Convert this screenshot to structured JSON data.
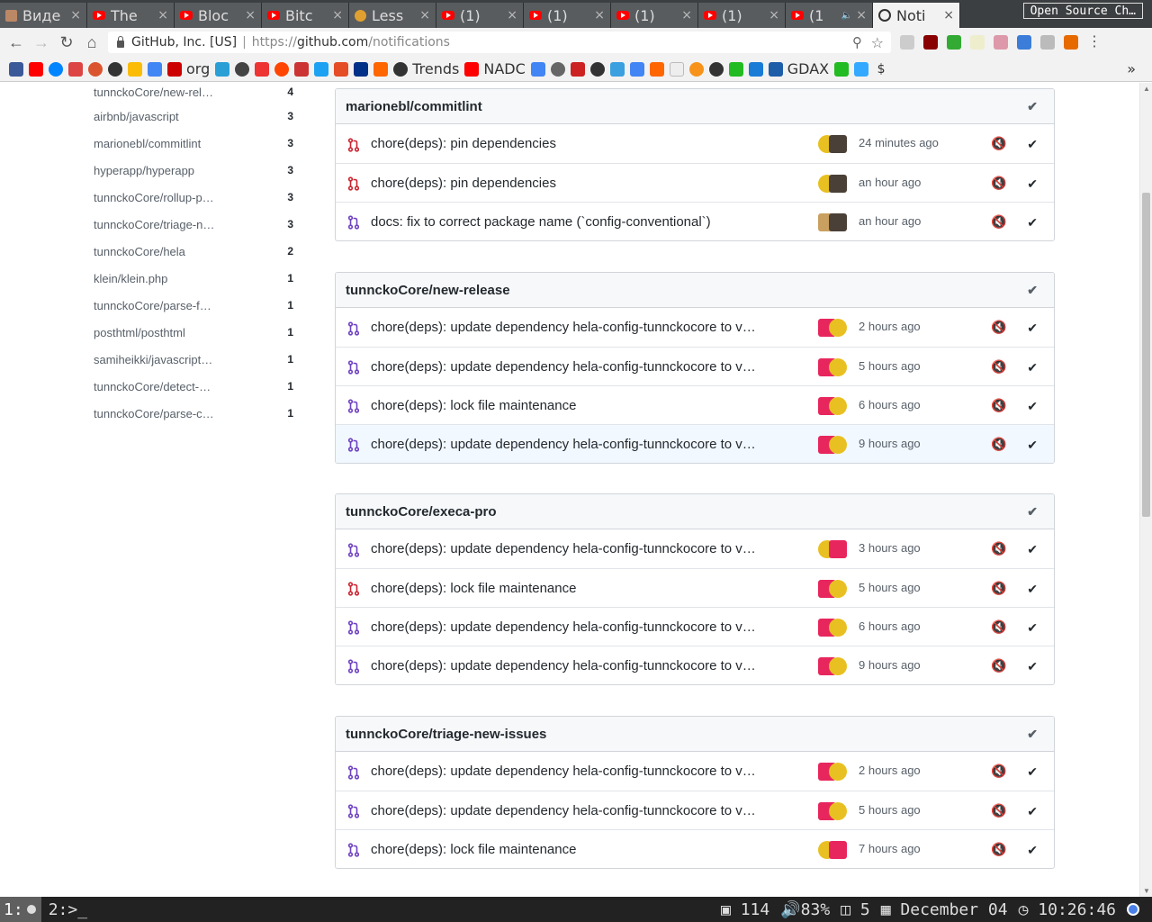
{
  "tabs": [
    {
      "title": "Виде",
      "kind": "vide"
    },
    {
      "title": "The",
      "kind": "yt"
    },
    {
      "title": "Bloc",
      "kind": "yt"
    },
    {
      "title": "Bitc",
      "kind": "yt"
    },
    {
      "title": "Less",
      "kind": "lesson"
    },
    {
      "title": "(1)",
      "kind": "yt"
    },
    {
      "title": "(1)",
      "kind": "yt"
    },
    {
      "title": "(1)",
      "kind": "yt"
    },
    {
      "title": "(1)",
      "kind": "yt"
    },
    {
      "title": "(1",
      "kind": "yt"
    },
    {
      "title": "Noti",
      "kind": "gh"
    }
  ],
  "tab_close": "×",
  "profile_button": "Open Source Ch…",
  "address": {
    "org": "GitHub, Inc. [US]",
    "scheme": "https://",
    "host": "github.com",
    "path": "/notifications"
  },
  "bookmarks": {
    "org": "org",
    "trends": "Trends",
    "nadc": "NADC",
    "gdax": "GDAX",
    "more": "»"
  },
  "sidebar": [
    {
      "repo": "tunnckoCore/new-rel…",
      "count": "4"
    },
    {
      "repo": "airbnb/javascript",
      "count": "3"
    },
    {
      "repo": "marionebl/commitlint",
      "count": "3"
    },
    {
      "repo": "hyperapp/hyperapp",
      "count": "3"
    },
    {
      "repo": "tunnckoCore/rollup-p…",
      "count": "3"
    },
    {
      "repo": "tunnckoCore/triage-n…",
      "count": "3"
    },
    {
      "repo": "tunnckoCore/hela",
      "count": "2"
    },
    {
      "repo": "klein/klein.php",
      "count": "1"
    },
    {
      "repo": "tunnckoCore/parse-f…",
      "count": "1"
    },
    {
      "repo": "posthtml/posthtml",
      "count": "1"
    },
    {
      "repo": "samiheikki/javascript…",
      "count": "1"
    },
    {
      "repo": "tunnckoCore/detect-…",
      "count": "1"
    },
    {
      "repo": "tunnckoCore/parse-c…",
      "count": "1"
    }
  ],
  "groups": [
    {
      "repo": "marionebl/commitlint",
      "items": [
        {
          "title": "chore(deps): pin dependencies",
          "time": "24 minutes ago",
          "state": "closed",
          "avatars": [
            "y",
            "d"
          ]
        },
        {
          "title": "chore(deps): pin dependencies",
          "time": "an hour ago",
          "state": "closed",
          "avatars": [
            "y",
            "d"
          ]
        },
        {
          "title": "docs: fix to correct package name (`config-conventional`)",
          "time": "an hour ago",
          "state": "merged",
          "avatars": [
            "t",
            "d"
          ]
        }
      ]
    },
    {
      "repo": "tunnckoCore/new-release",
      "items": [
        {
          "title": "chore(deps): update dependency hela-config-tunnckocore to v…",
          "time": "2 hours ago",
          "state": "merged",
          "avatars": [
            "r",
            "y"
          ]
        },
        {
          "title": "chore(deps): update dependency hela-config-tunnckocore to v…",
          "time": "5 hours ago",
          "state": "merged",
          "avatars": [
            "r",
            "y"
          ]
        },
        {
          "title": "chore(deps): lock file maintenance",
          "time": "6 hours ago",
          "state": "merged",
          "avatars": [
            "r",
            "y"
          ]
        },
        {
          "title": "chore(deps): update dependency hela-config-tunnckocore to v…",
          "time": "9 hours ago",
          "state": "merged",
          "avatars": [
            "r",
            "y"
          ],
          "highlight": true
        }
      ]
    },
    {
      "repo": "tunnckoCore/execa-pro",
      "items": [
        {
          "title": "chore(deps): update dependency hela-config-tunnckocore to v…",
          "time": "3 hours ago",
          "state": "merged",
          "avatars": [
            "y",
            "r"
          ]
        },
        {
          "title": "chore(deps): lock file maintenance",
          "time": "5 hours ago",
          "state": "closed",
          "avatars": [
            "r",
            "y"
          ]
        },
        {
          "title": "chore(deps): update dependency hela-config-tunnckocore to v…",
          "time": "6 hours ago",
          "state": "merged",
          "avatars": [
            "r",
            "y"
          ]
        },
        {
          "title": "chore(deps): update dependency hela-config-tunnckocore to v…",
          "time": "9 hours ago",
          "state": "merged",
          "avatars": [
            "r",
            "y"
          ]
        }
      ]
    },
    {
      "repo": "tunnckoCore/triage-new-issues",
      "items": [
        {
          "title": "chore(deps): update dependency hela-config-tunnckocore to v…",
          "time": "2 hours ago",
          "state": "merged",
          "avatars": [
            "r",
            "y"
          ]
        },
        {
          "title": "chore(deps): update dependency hela-config-tunnckocore to v…",
          "time": "5 hours ago",
          "state": "merged",
          "avatars": [
            "r",
            "y"
          ]
        },
        {
          "title": "chore(deps): lock file maintenance",
          "time": "7 hours ago",
          "state": "merged",
          "avatars": [
            "y",
            "r"
          ]
        }
      ]
    }
  ],
  "status_bar": {
    "workspace1": "1:",
    "workspace2": "2:>_",
    "packages": "114",
    "volume": "83%",
    "trash": "5",
    "date": "December 04",
    "time": "10:26:46"
  },
  "colors": {
    "merged": "#6f42c1",
    "closed": "#cb2431"
  }
}
